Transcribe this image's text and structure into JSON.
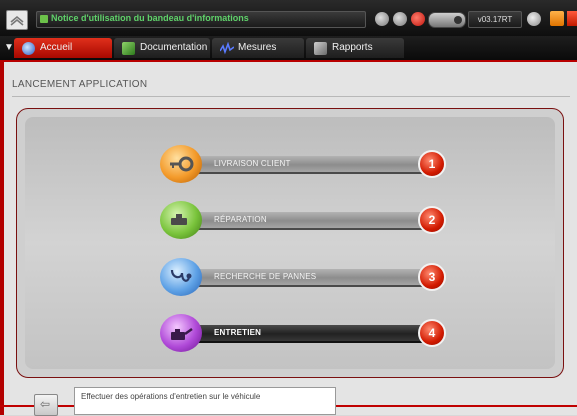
{
  "window": {
    "title": "Notice d'utilisation du bandeau d'informations",
    "version": "v03.17RT"
  },
  "tabs": [
    {
      "label": "Accueil",
      "active": true
    },
    {
      "label": "Documentation"
    },
    {
      "label": "Mesures"
    },
    {
      "label": "Rapports"
    }
  ],
  "page": {
    "title": "LANCEMENT APPLICATION"
  },
  "menu": [
    {
      "number": "1",
      "label": "LIVRAISON CLIENT",
      "icon": "key-icon",
      "color": "#f39a2a"
    },
    {
      "number": "2",
      "label": "RÉPARATION",
      "icon": "wrench-icon",
      "color": "#7ac43c"
    },
    {
      "number": "3",
      "label": "RECHERCHE DE PANNES",
      "icon": "stethoscope-icon",
      "color": "#5fa2e6"
    },
    {
      "number": "4",
      "label": "ENTRETIEN",
      "icon": "oil-can-icon",
      "color": "#b04ad8",
      "selected": true
    }
  ],
  "status": {
    "text": "Effectuer des opérations d'entretien sur le véhicule"
  },
  "colors": {
    "accent": "#c00000",
    "badge": "#d21a00"
  }
}
